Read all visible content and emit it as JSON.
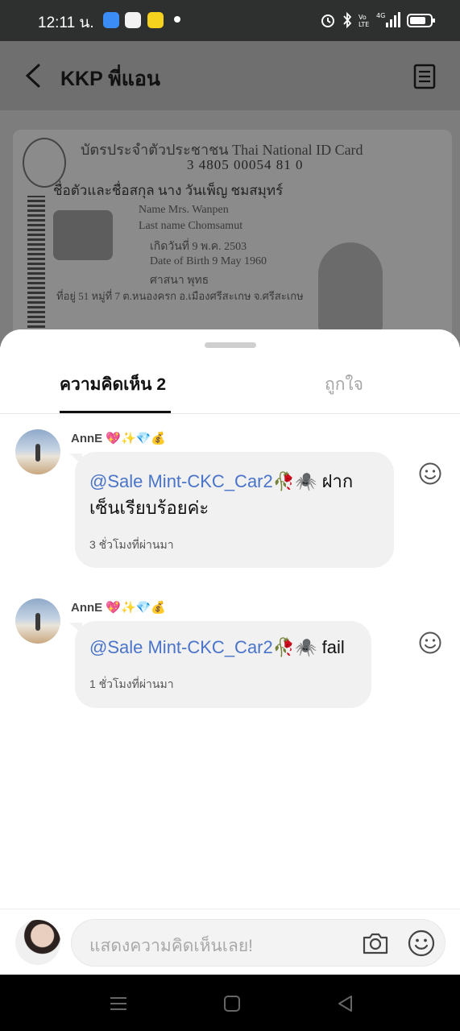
{
  "status_bar": {
    "time": "12:11 น.",
    "app_icons": [
      {
        "name": "messenger-app-icon",
        "color": "#3b8cf5"
      },
      {
        "name": "line-app-icon",
        "color": "#f2f2f2"
      },
      {
        "name": "g-app-icon",
        "color": "#f5d21d"
      }
    ],
    "right_icons": [
      "alarm-icon",
      "bluetooth-icon",
      "volte-icon",
      "signal-icon",
      "battery-icon"
    ],
    "network_label": "4G"
  },
  "header": {
    "title": "KKP พี่แอน"
  },
  "background_image": {
    "title": "บัตรประจำตัวประชาชน Thai National ID Card",
    "number": "3 4805 00054 81 0",
    "name_th": "ชื่อตัวและชื่อสกุล นาง วันเพ็ญ ชมสมุทร์",
    "name_en": "Name  Mrs. Wanpen",
    "lastname_en": "Last name  Chomsamut",
    "dob_th": "เกิดวันที่  9 พ.ค. 2503",
    "dob_en": "Date of Birth  9 May 1960",
    "religion": "ศาสนา  พุทธ",
    "address": "ที่อยู่ 51 หมู่ที่ 7 ต.หนองครก อ.เมืองศรีสะเกษ จ.ศรีสะเกษ"
  },
  "sheet": {
    "tabs": [
      {
        "label": "ความคิดเห็น 2",
        "active": true
      },
      {
        "label": "ถูกใจ",
        "active": false
      }
    ],
    "comments": [
      {
        "author": "AnnE 💖✨💎💰",
        "mention": "@Sale Mint-CKC_Car2🥀🕷️",
        "text_line1": " ฝาก",
        "text_line2": "เซ็นเรียบร้อยค่ะ",
        "time": "3 ชั่วโมงที่ผ่านมา"
      },
      {
        "author": "AnnE 💖✨💎💰",
        "mention": "@Sale Mint-CKC_Car2🥀🕷️",
        "text_line1": " fail",
        "text_line2": "",
        "time": "1 ชั่วโมงที่ผ่านมา"
      }
    ]
  },
  "composer": {
    "placeholder": "แสดงความคิดเห็นเลย!"
  },
  "colors": {
    "mention": "#4a74c9",
    "bubble": "#f1f1f1",
    "status_bar": "#2e3030"
  }
}
